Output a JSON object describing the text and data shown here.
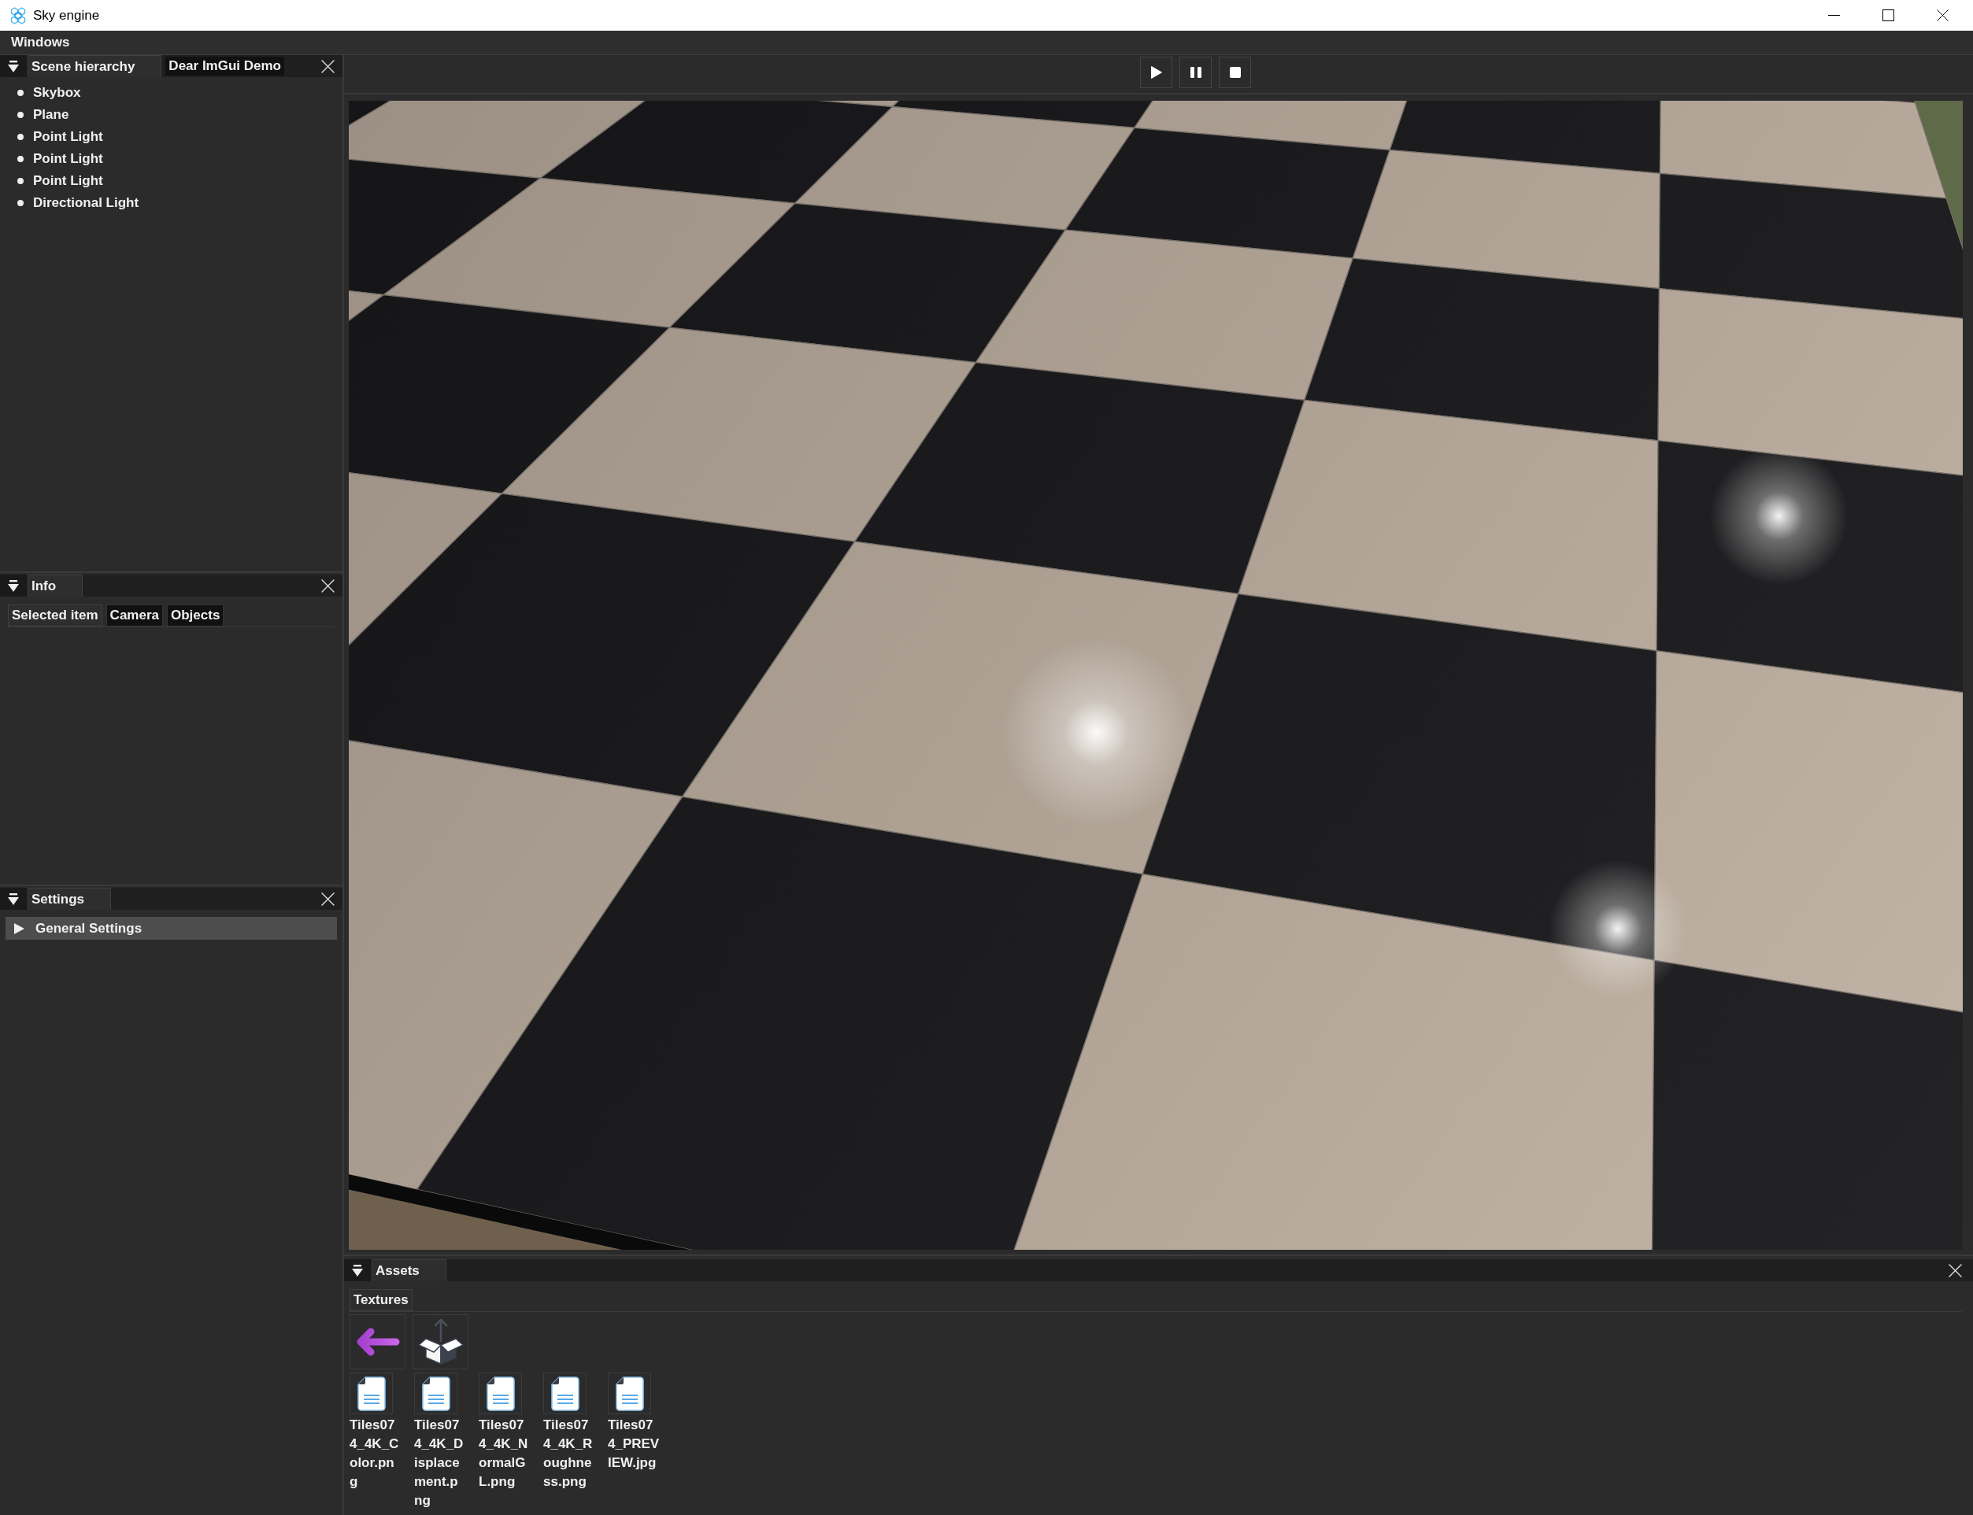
{
  "window": {
    "title": "Sky engine"
  },
  "menu_bar": [
    "Windows"
  ],
  "scene_panel": {
    "tabs": [
      {
        "label": "Scene hierarchy",
        "selected": true
      },
      {
        "label": "Dear ImGui Demo",
        "selected": false
      }
    ],
    "items": [
      "Skybox",
      "Plane",
      "Point Light",
      "Point Light",
      "Point Light",
      "Directional Light"
    ]
  },
  "info_panel": {
    "tabs": [
      {
        "label": "Info",
        "selected": true
      }
    ],
    "inner_tabs": [
      {
        "label": "Selected item",
        "selected": true
      },
      {
        "label": "Camera",
        "selected": false
      },
      {
        "label": "Objects",
        "selected": false
      }
    ]
  },
  "settings_panel": {
    "tabs": [
      {
        "label": "Settings",
        "selected": true
      }
    ],
    "sections": [
      {
        "label": "General Settings",
        "expanded": false
      }
    ]
  },
  "assets_panel": {
    "tabs": [
      {
        "label": "Assets",
        "selected": true
      }
    ],
    "inner_tabs": [
      {
        "label": "Textures",
        "selected": true
      }
    ],
    "files": [
      "Tiles074_4K_Color.png",
      "Tiles074_4K_Displacement.png",
      "Tiles074_4K_NormalGL.png",
      "Tiles074_4K_Roughness.png",
      "Tiles074_PREVIEW.jpg"
    ]
  }
}
